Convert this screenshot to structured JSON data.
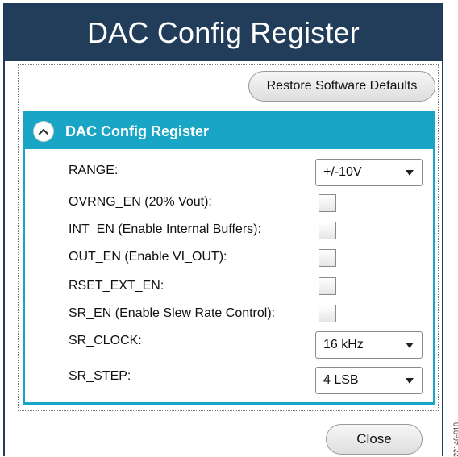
{
  "window": {
    "title": "DAC Config Register"
  },
  "toolbar": {
    "restore_label": "Restore Software Defaults"
  },
  "panel": {
    "header": "DAC Config Register",
    "collapse_icon": "chevron-up-icon",
    "fields": {
      "range": {
        "label": "RANGE:",
        "value": "+/-10V"
      },
      "ovrng_en": {
        "label": "OVRNG_EN (20% Vout):",
        "checked": false
      },
      "int_en": {
        "label": "INT_EN (Enable Internal Buffers):",
        "checked": false
      },
      "out_en": {
        "label": "OUT_EN (Enable VI_OUT):",
        "checked": false
      },
      "rset_ext_en": {
        "label": "RSET_EXT_EN:",
        "checked": false
      },
      "sr_en": {
        "label": "SR_EN (Enable Slew Rate Control):",
        "checked": false
      },
      "sr_clock": {
        "label": "SR_CLOCK:",
        "value": "16 kHz"
      },
      "sr_step": {
        "label": "SR_STEP:",
        "value": "4 LSB"
      }
    }
  },
  "footer": {
    "close_label": "Close"
  },
  "side_note": "22146-010",
  "colors": {
    "title_bar": "#223d5a",
    "panel_accent": "#19a5c5"
  }
}
